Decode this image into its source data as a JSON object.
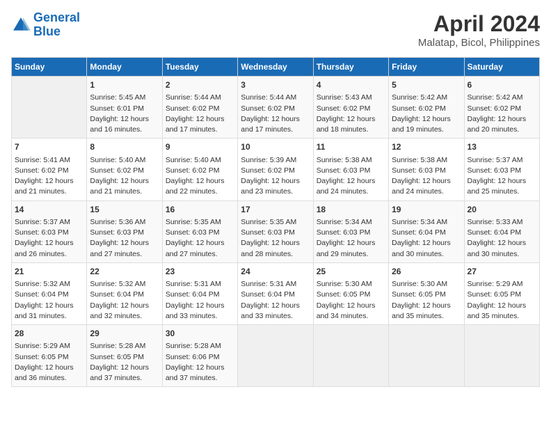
{
  "header": {
    "logo_line1": "General",
    "logo_line2": "Blue",
    "title": "April 2024",
    "subtitle": "Malatap, Bicol, Philippines"
  },
  "days_of_week": [
    "Sunday",
    "Monday",
    "Tuesday",
    "Wednesday",
    "Thursday",
    "Friday",
    "Saturday"
  ],
  "weeks": [
    [
      {
        "day": "",
        "info": ""
      },
      {
        "day": "1",
        "info": "Sunrise: 5:45 AM\nSunset: 6:01 PM\nDaylight: 12 hours\nand 16 minutes."
      },
      {
        "day": "2",
        "info": "Sunrise: 5:44 AM\nSunset: 6:02 PM\nDaylight: 12 hours\nand 17 minutes."
      },
      {
        "day": "3",
        "info": "Sunrise: 5:44 AM\nSunset: 6:02 PM\nDaylight: 12 hours\nand 17 minutes."
      },
      {
        "day": "4",
        "info": "Sunrise: 5:43 AM\nSunset: 6:02 PM\nDaylight: 12 hours\nand 18 minutes."
      },
      {
        "day": "5",
        "info": "Sunrise: 5:42 AM\nSunset: 6:02 PM\nDaylight: 12 hours\nand 19 minutes."
      },
      {
        "day": "6",
        "info": "Sunrise: 5:42 AM\nSunset: 6:02 PM\nDaylight: 12 hours\nand 20 minutes."
      }
    ],
    [
      {
        "day": "7",
        "info": "Sunrise: 5:41 AM\nSunset: 6:02 PM\nDaylight: 12 hours\nand 21 minutes."
      },
      {
        "day": "8",
        "info": "Sunrise: 5:40 AM\nSunset: 6:02 PM\nDaylight: 12 hours\nand 21 minutes."
      },
      {
        "day": "9",
        "info": "Sunrise: 5:40 AM\nSunset: 6:02 PM\nDaylight: 12 hours\nand 22 minutes."
      },
      {
        "day": "10",
        "info": "Sunrise: 5:39 AM\nSunset: 6:02 PM\nDaylight: 12 hours\nand 23 minutes."
      },
      {
        "day": "11",
        "info": "Sunrise: 5:38 AM\nSunset: 6:03 PM\nDaylight: 12 hours\nand 24 minutes."
      },
      {
        "day": "12",
        "info": "Sunrise: 5:38 AM\nSunset: 6:03 PM\nDaylight: 12 hours\nand 24 minutes."
      },
      {
        "day": "13",
        "info": "Sunrise: 5:37 AM\nSunset: 6:03 PM\nDaylight: 12 hours\nand 25 minutes."
      }
    ],
    [
      {
        "day": "14",
        "info": "Sunrise: 5:37 AM\nSunset: 6:03 PM\nDaylight: 12 hours\nand 26 minutes."
      },
      {
        "day": "15",
        "info": "Sunrise: 5:36 AM\nSunset: 6:03 PM\nDaylight: 12 hours\nand 27 minutes."
      },
      {
        "day": "16",
        "info": "Sunrise: 5:35 AM\nSunset: 6:03 PM\nDaylight: 12 hours\nand 27 minutes."
      },
      {
        "day": "17",
        "info": "Sunrise: 5:35 AM\nSunset: 6:03 PM\nDaylight: 12 hours\nand 28 minutes."
      },
      {
        "day": "18",
        "info": "Sunrise: 5:34 AM\nSunset: 6:03 PM\nDaylight: 12 hours\nand 29 minutes."
      },
      {
        "day": "19",
        "info": "Sunrise: 5:34 AM\nSunset: 6:04 PM\nDaylight: 12 hours\nand 30 minutes."
      },
      {
        "day": "20",
        "info": "Sunrise: 5:33 AM\nSunset: 6:04 PM\nDaylight: 12 hours\nand 30 minutes."
      }
    ],
    [
      {
        "day": "21",
        "info": "Sunrise: 5:32 AM\nSunset: 6:04 PM\nDaylight: 12 hours\nand 31 minutes."
      },
      {
        "day": "22",
        "info": "Sunrise: 5:32 AM\nSunset: 6:04 PM\nDaylight: 12 hours\nand 32 minutes."
      },
      {
        "day": "23",
        "info": "Sunrise: 5:31 AM\nSunset: 6:04 PM\nDaylight: 12 hours\nand 33 minutes."
      },
      {
        "day": "24",
        "info": "Sunrise: 5:31 AM\nSunset: 6:04 PM\nDaylight: 12 hours\nand 33 minutes."
      },
      {
        "day": "25",
        "info": "Sunrise: 5:30 AM\nSunset: 6:05 PM\nDaylight: 12 hours\nand 34 minutes."
      },
      {
        "day": "26",
        "info": "Sunrise: 5:30 AM\nSunset: 6:05 PM\nDaylight: 12 hours\nand 35 minutes."
      },
      {
        "day": "27",
        "info": "Sunrise: 5:29 AM\nSunset: 6:05 PM\nDaylight: 12 hours\nand 35 minutes."
      }
    ],
    [
      {
        "day": "28",
        "info": "Sunrise: 5:29 AM\nSunset: 6:05 PM\nDaylight: 12 hours\nand 36 minutes."
      },
      {
        "day": "29",
        "info": "Sunrise: 5:28 AM\nSunset: 6:05 PM\nDaylight: 12 hours\nand 37 minutes."
      },
      {
        "day": "30",
        "info": "Sunrise: 5:28 AM\nSunset: 6:06 PM\nDaylight: 12 hours\nand 37 minutes."
      },
      {
        "day": "",
        "info": ""
      },
      {
        "day": "",
        "info": ""
      },
      {
        "day": "",
        "info": ""
      },
      {
        "day": "",
        "info": ""
      }
    ]
  ]
}
